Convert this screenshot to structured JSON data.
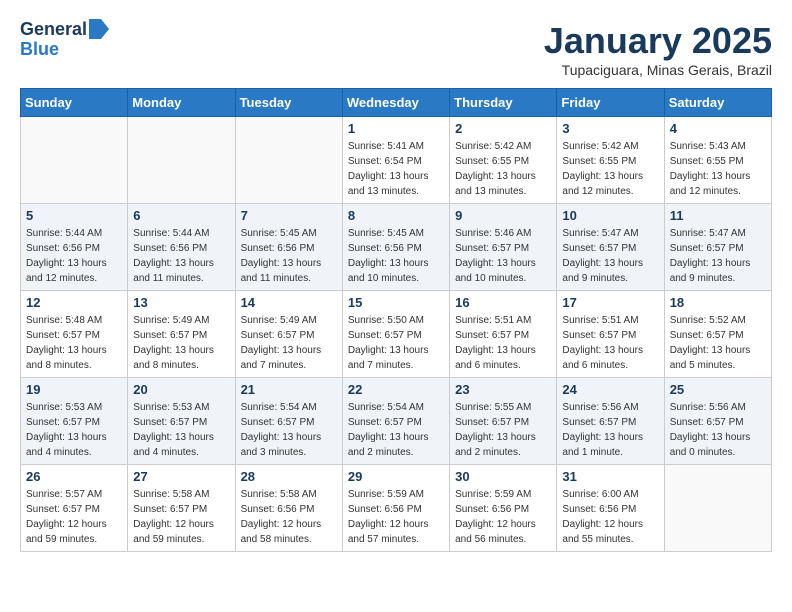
{
  "header": {
    "logo_line1": "General",
    "logo_line2": "Blue",
    "month_title": "January 2025",
    "subtitle": "Tupaciguara, Minas Gerais, Brazil"
  },
  "weekdays": [
    "Sunday",
    "Monday",
    "Tuesday",
    "Wednesday",
    "Thursday",
    "Friday",
    "Saturday"
  ],
  "weeks": [
    [
      {
        "day": "",
        "info": ""
      },
      {
        "day": "",
        "info": ""
      },
      {
        "day": "",
        "info": ""
      },
      {
        "day": "1",
        "info": "Sunrise: 5:41 AM\nSunset: 6:54 PM\nDaylight: 13 hours\nand 13 minutes."
      },
      {
        "day": "2",
        "info": "Sunrise: 5:42 AM\nSunset: 6:55 PM\nDaylight: 13 hours\nand 13 minutes."
      },
      {
        "day": "3",
        "info": "Sunrise: 5:42 AM\nSunset: 6:55 PM\nDaylight: 13 hours\nand 12 minutes."
      },
      {
        "day": "4",
        "info": "Sunrise: 5:43 AM\nSunset: 6:55 PM\nDaylight: 13 hours\nand 12 minutes."
      }
    ],
    [
      {
        "day": "5",
        "info": "Sunrise: 5:44 AM\nSunset: 6:56 PM\nDaylight: 13 hours\nand 12 minutes."
      },
      {
        "day": "6",
        "info": "Sunrise: 5:44 AM\nSunset: 6:56 PM\nDaylight: 13 hours\nand 11 minutes."
      },
      {
        "day": "7",
        "info": "Sunrise: 5:45 AM\nSunset: 6:56 PM\nDaylight: 13 hours\nand 11 minutes."
      },
      {
        "day": "8",
        "info": "Sunrise: 5:45 AM\nSunset: 6:56 PM\nDaylight: 13 hours\nand 10 minutes."
      },
      {
        "day": "9",
        "info": "Sunrise: 5:46 AM\nSunset: 6:57 PM\nDaylight: 13 hours\nand 10 minutes."
      },
      {
        "day": "10",
        "info": "Sunrise: 5:47 AM\nSunset: 6:57 PM\nDaylight: 13 hours\nand 9 minutes."
      },
      {
        "day": "11",
        "info": "Sunrise: 5:47 AM\nSunset: 6:57 PM\nDaylight: 13 hours\nand 9 minutes."
      }
    ],
    [
      {
        "day": "12",
        "info": "Sunrise: 5:48 AM\nSunset: 6:57 PM\nDaylight: 13 hours\nand 8 minutes."
      },
      {
        "day": "13",
        "info": "Sunrise: 5:49 AM\nSunset: 6:57 PM\nDaylight: 13 hours\nand 8 minutes."
      },
      {
        "day": "14",
        "info": "Sunrise: 5:49 AM\nSunset: 6:57 PM\nDaylight: 13 hours\nand 7 minutes."
      },
      {
        "day": "15",
        "info": "Sunrise: 5:50 AM\nSunset: 6:57 PM\nDaylight: 13 hours\nand 7 minutes."
      },
      {
        "day": "16",
        "info": "Sunrise: 5:51 AM\nSunset: 6:57 PM\nDaylight: 13 hours\nand 6 minutes."
      },
      {
        "day": "17",
        "info": "Sunrise: 5:51 AM\nSunset: 6:57 PM\nDaylight: 13 hours\nand 6 minutes."
      },
      {
        "day": "18",
        "info": "Sunrise: 5:52 AM\nSunset: 6:57 PM\nDaylight: 13 hours\nand 5 minutes."
      }
    ],
    [
      {
        "day": "19",
        "info": "Sunrise: 5:53 AM\nSunset: 6:57 PM\nDaylight: 13 hours\nand 4 minutes."
      },
      {
        "day": "20",
        "info": "Sunrise: 5:53 AM\nSunset: 6:57 PM\nDaylight: 13 hours\nand 4 minutes."
      },
      {
        "day": "21",
        "info": "Sunrise: 5:54 AM\nSunset: 6:57 PM\nDaylight: 13 hours\nand 3 minutes."
      },
      {
        "day": "22",
        "info": "Sunrise: 5:54 AM\nSunset: 6:57 PM\nDaylight: 13 hours\nand 2 minutes."
      },
      {
        "day": "23",
        "info": "Sunrise: 5:55 AM\nSunset: 6:57 PM\nDaylight: 13 hours\nand 2 minutes."
      },
      {
        "day": "24",
        "info": "Sunrise: 5:56 AM\nSunset: 6:57 PM\nDaylight: 13 hours\nand 1 minute."
      },
      {
        "day": "25",
        "info": "Sunrise: 5:56 AM\nSunset: 6:57 PM\nDaylight: 13 hours\nand 0 minutes."
      }
    ],
    [
      {
        "day": "26",
        "info": "Sunrise: 5:57 AM\nSunset: 6:57 PM\nDaylight: 12 hours\nand 59 minutes."
      },
      {
        "day": "27",
        "info": "Sunrise: 5:58 AM\nSunset: 6:57 PM\nDaylight: 12 hours\nand 59 minutes."
      },
      {
        "day": "28",
        "info": "Sunrise: 5:58 AM\nSunset: 6:56 PM\nDaylight: 12 hours\nand 58 minutes."
      },
      {
        "day": "29",
        "info": "Sunrise: 5:59 AM\nSunset: 6:56 PM\nDaylight: 12 hours\nand 57 minutes."
      },
      {
        "day": "30",
        "info": "Sunrise: 5:59 AM\nSunset: 6:56 PM\nDaylight: 12 hours\nand 56 minutes."
      },
      {
        "day": "31",
        "info": "Sunrise: 6:00 AM\nSunset: 6:56 PM\nDaylight: 12 hours\nand 55 minutes."
      },
      {
        "day": "",
        "info": ""
      }
    ]
  ]
}
